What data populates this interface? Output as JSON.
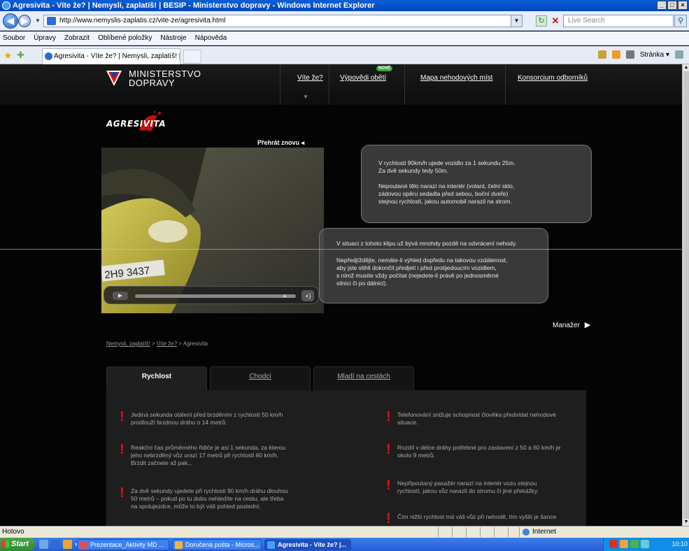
{
  "browser": {
    "window_title": "Agresivita - Víte že? | Nemysli, zaplatíš! | BESIP - Ministerstvo dopravy - Windows Internet Explorer",
    "url": "http://www.nemyslis-zaplatis.cz/vite-ze/agresivita.html",
    "search_placeholder": "Live Search",
    "menu": [
      "Soubor",
      "Úpravy",
      "Zobrazit",
      "Oblíbené položky",
      "Nástroje",
      "Nápověda"
    ],
    "tab_title": "Agresivita - Víte že? | Nemysli, zaplatíš! | BESIP - Mini...",
    "command_page": "Stránka",
    "status_text": "Hotovo",
    "zone": "Internet"
  },
  "site": {
    "logo_line1": "MINISTERSTVO",
    "logo_line2": "DOPRAVY",
    "nav": [
      {
        "label": "Víte že?"
      },
      {
        "label": "Výpovědi obětí",
        "badge": "NOVÉ"
      },
      {
        "label": "Mapa nehodových míst"
      },
      {
        "label": "Konsorcium odborníků"
      }
    ],
    "section_logo": "AGRESIVITA",
    "replay_label": "Přehrát znovu",
    "plate_text": "2H9 3437",
    "bubble1": [
      "V rychlosti 90km/h ujede vozidlo za 1 sekundu 25m.\nZa dvě sekundy tedy 50m.",
      "Nepoutané tělo narazí na interiér (volant, čelní sklo,\nzádovou opěru sedadla před sebou, boční dveře)\nstejnou rychlostí, jakou automobil narazil na strom."
    ],
    "bubble2": [
      "V situaci z tohoto klipu už bývá mnohdy pozdě na odvrácení nehody.",
      "Nepředjíždějte, nemáte-li výhled dopředu na takovou vzdálenost,\naby jste stihli dokončit předjetí i před protijedoucím vozidlem,\ns nímž musíte vždy počítat (nejedete-li právě po jednosměrné\nsilnici či po dálnici)."
    ],
    "manager_label": "Manažer",
    "breadcrumb": [
      "Nemysli, zaplatíš!",
      "Víte že?",
      "Agresivita"
    ],
    "tabs": [
      "Rychlost",
      "Chodci",
      "Mladí na cestách"
    ],
    "facts_left": [
      "Jediná sekunda otálení před brzděním z rychlosti 50 km/h\nprodlouží brzdnou dráhu o 14 metrů.",
      "Reakční čas průměrného řidiče je asi 1 sekunda, za kterou\njeho nebrzděný vůz urazí 17 metrů při rychlosti 60 km/h.\nBrzdit začnete až pak...",
      "Za dvě sekundy ujedete při rychlosti 90 km/h dráhu dlouhou\n50 metrů – pokud po tu dobu nehledíte na cestu, ale třeba\nna spolujezdce, může to být váš pohled poslední."
    ],
    "facts_right": [
      "Telefonování snižuje schopnost člověka předvídat nehodové\nsituace.",
      "Rozdíl v délce dráhy potřebné pro zastavení z 50 a 60 km/h je\nokolo 9 metrů.",
      "Nepřipoutaný pasažér narazí na interiér vozu stejnou\nrychlostí, jakou vůz narazil do stromu či jiné překážky.",
      "Čím nižší rychlost má váš vůz při nehodě, tím vyšší je šance"
    ]
  },
  "taskbar": {
    "start_label": "Start",
    "tasks": [
      "Prezentace_Aktivity MD ...",
      "Doručená pošta - Micros...",
      "Agresivita - Víte že? |..."
    ],
    "clock": "10:10"
  },
  "colors": {
    "accent_red": "#d11111",
    "new_badge": "#3ca23c",
    "page_bg": "#040404"
  }
}
